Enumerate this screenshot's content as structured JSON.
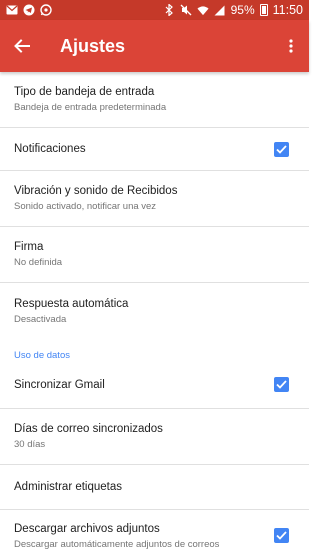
{
  "status_bar": {
    "battery": "95%",
    "time": "11:50",
    "left_icons": [
      "mail-icon",
      "telegram-icon",
      "whatsapp-icon"
    ],
    "right_icons": [
      "bluetooth-icon",
      "mute-icon",
      "wifi-icon",
      "signal-icon",
      "battery-icon"
    ]
  },
  "app_bar": {
    "title": "Ajustes",
    "color": "#db4437",
    "status_color": "#c53929"
  },
  "items": [
    {
      "title": "Tipo de bandeja de entrada",
      "subtitle": "Bandeja de entrada predeterminada"
    },
    {
      "title": "Notificaciones",
      "checked": true
    },
    {
      "title": "Vibración y sonido de Recibidos",
      "subtitle": "Sonido activado, notificar una vez"
    },
    {
      "title": "Firma",
      "subtitle": "No definida"
    },
    {
      "title": "Respuesta automática",
      "subtitle": "Desactivada"
    }
  ],
  "data_section": {
    "header": "Uso de datos",
    "items": [
      {
        "title": "Sincronizar Gmail",
        "checked": true
      },
      {
        "title": "Días de correo sincronizados",
        "subtitle": "30 días"
      },
      {
        "title": "Administrar etiquetas"
      },
      {
        "title": "Descargar archivos adjuntos",
        "subtitle": "Descargar automáticamente adjuntos de correos",
        "checked": true
      }
    ]
  },
  "accent_color": "#4285f4"
}
